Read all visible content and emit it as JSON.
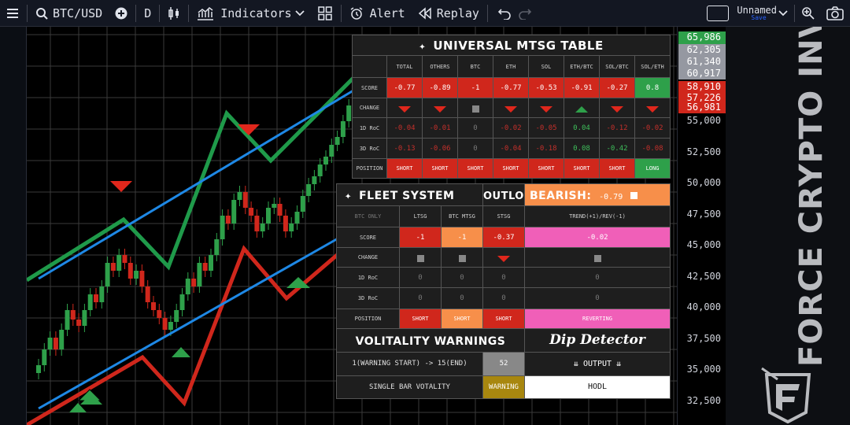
{
  "toolbar": {
    "symbol": "BTC/USD",
    "interval": "D",
    "indicators_label": "Indicators",
    "alert_label": "Alert",
    "replay_label": "Replay",
    "layout_name": "Unnamed",
    "save_label": "Save"
  },
  "price_axis": {
    "ticks": [
      "55,000",
      "52,500",
      "50,000",
      "47,500",
      "45,000",
      "42,500",
      "40,000",
      "37,500",
      "35,000",
      "32,500"
    ],
    "tags": [
      {
        "label": "65,986",
        "color": "#2ea04a"
      },
      {
        "label": "62,305",
        "color": "#9598a1"
      },
      {
        "label": "61,340",
        "color": "#9598a1"
      },
      {
        "label": "60,917",
        "color": "#9598a1"
      },
      {
        "label": "58,910",
        "color": "#d0271c"
      },
      {
        "label": "57,226",
        "color": "#d0271c"
      },
      {
        "label": "56,981",
        "color": "#d0271c"
      }
    ]
  },
  "brand": {
    "text": "FORCE CRYPTO INVESTING"
  },
  "mtsg": {
    "title": "UNIVERSAL MTSG TABLE",
    "columns": [
      "TOTAL",
      "OTHERS",
      "BTC",
      "ETH",
      "SOL",
      "ETH/BTC",
      "SOL/BTC",
      "SOL/ETH"
    ],
    "row_labels": [
      "SCORE",
      "CHANGE",
      "1D RoC",
      "3D RoC",
      "POSITION"
    ],
    "score": [
      "-0.77",
      "-0.89",
      "-1",
      "-0.77",
      "-0.53",
      "-0.91",
      "-0.27",
      "0.8"
    ],
    "score_color": [
      "red",
      "red",
      "red",
      "red",
      "red",
      "red",
      "red",
      "green"
    ],
    "change": [
      "down",
      "down",
      "flat",
      "down",
      "down",
      "up",
      "down",
      "down"
    ],
    "roc1": [
      "-0.04",
      "-0.01",
      "0",
      "-0.02",
      "-0.05",
      "0.04",
      "-0.12",
      "-0.02"
    ],
    "roc1_color": [
      "red",
      "red",
      "gray",
      "red",
      "red",
      "green",
      "red",
      "red"
    ],
    "roc3": [
      "-0.13",
      "-0.06",
      "0",
      "-0.04",
      "-0.18",
      "0.08",
      "-0.42",
      "-0.08"
    ],
    "roc3_color": [
      "red",
      "red",
      "gray",
      "red",
      "red",
      "green",
      "green",
      "red"
    ],
    "position": [
      "SHORT",
      "SHORT",
      "SHORT",
      "SHORT",
      "SHORT",
      "SHORT",
      "SHORT",
      "LONG"
    ],
    "position_color": [
      "red",
      "red",
      "red",
      "red",
      "red",
      "red",
      "red",
      "green"
    ]
  },
  "fleet": {
    "title": "FLEET SYSTEM",
    "outlook_label": "OUTLOOK",
    "bearish_label": "BEARISH:",
    "bearish_value": "-0.79",
    "corner_label": "BTC ONLY",
    "columns": [
      "LTSG",
      "BTC MTSG",
      "STSG",
      "TREND(+1)/REV(-1)"
    ],
    "row_labels": [
      "SCORE",
      "CHANGE",
      "1D RoC",
      "3D RoC",
      "POSITION"
    ],
    "score": [
      "-1",
      "-1",
      "-0.37",
      "-0.02"
    ],
    "score_color": [
      "red",
      "orange",
      "red",
      "pink"
    ],
    "change": [
      "flat",
      "flat",
      "down",
      "flat"
    ],
    "roc1": [
      "0",
      "0",
      "0",
      "0"
    ],
    "roc3": [
      "0",
      "0",
      "0",
      "0"
    ],
    "position": [
      "SHORT",
      "SHORT",
      "SHORT",
      "REVERTING"
    ],
    "position_color": [
      "red",
      "orange",
      "red",
      "pink"
    ]
  },
  "volatility": {
    "title": "VOLITALITY WARNINGS",
    "dip_title": "Dip Detector",
    "row1_label": "1(WARNING START) -> 15(END)",
    "row1_value": "52",
    "output_label": "OUTPUT",
    "row2_label": "SINGLE BAR VOTALITY",
    "row2_value": "WARNING",
    "dip_output": "HODL"
  },
  "colors": {
    "bull": "#2ea04a",
    "bear": "#d0271c",
    "channel_blue": "#1e88e5",
    "bg": "#000000"
  }
}
